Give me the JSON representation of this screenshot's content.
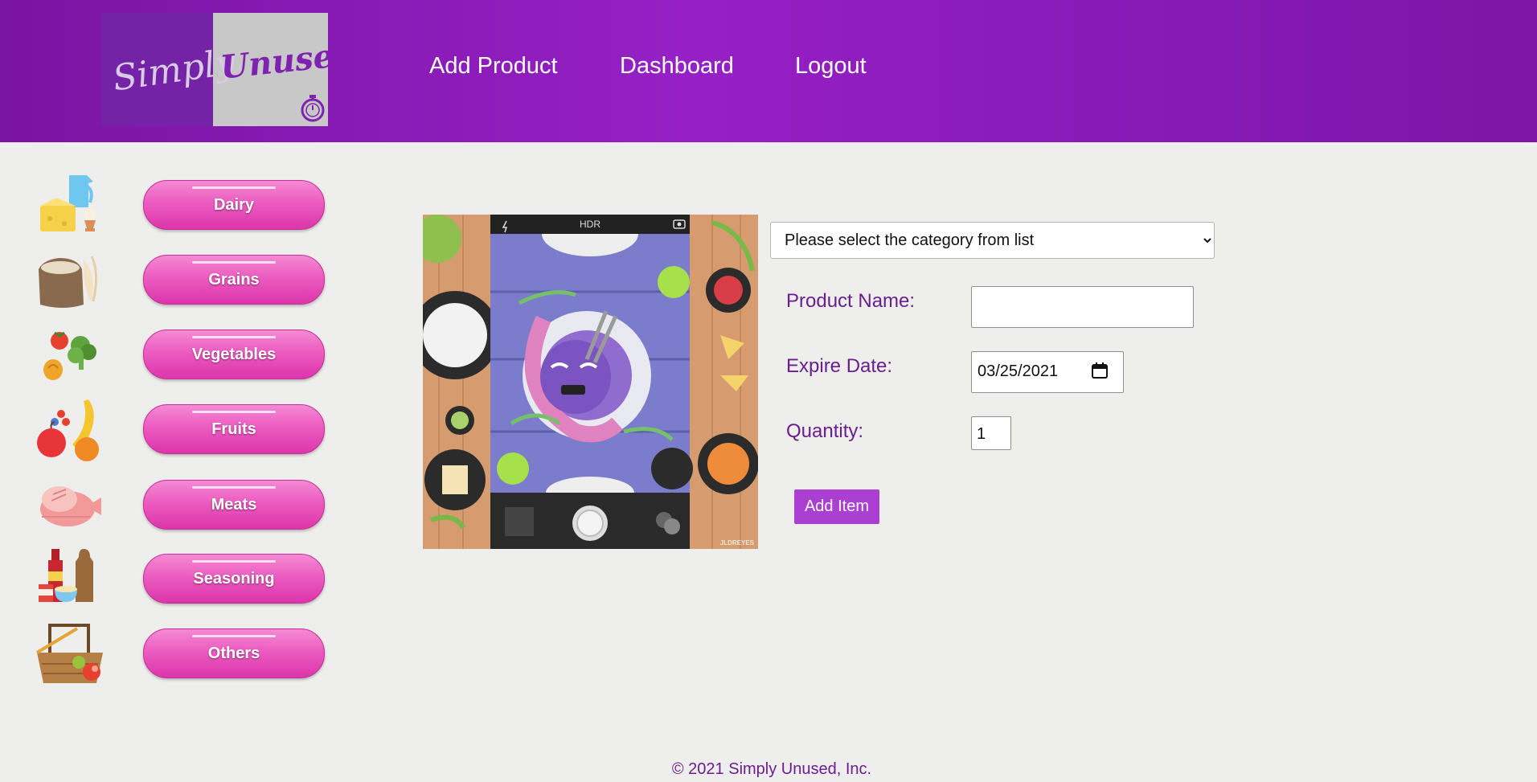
{
  "brand": {
    "logo_text_1": "Simply",
    "logo_text_2": "Unused",
    "accent": "#9620c6"
  },
  "nav": [
    {
      "label": "Add Product"
    },
    {
      "label": "Dashboard"
    },
    {
      "label": "Logout"
    }
  ],
  "categories": [
    {
      "label": "Dairy",
      "icon": "dairy-icon"
    },
    {
      "label": "Grains",
      "icon": "grain-sack-icon"
    },
    {
      "label": "Vegetables",
      "icon": "vegetables-icon"
    },
    {
      "label": "Fruits",
      "icon": "fruits-icon"
    },
    {
      "label": "Meats",
      "icon": "ham-icon"
    },
    {
      "label": "Seasoning",
      "icon": "condiments-icon"
    },
    {
      "label": "Others",
      "icon": "basket-icon"
    }
  ],
  "phone": {
    "hdr_label": "HDR",
    "watermark": "JLDREYES"
  },
  "form": {
    "category_select": {
      "selected": "Please select the category from list"
    },
    "product_name": {
      "label": "Product Name:",
      "value": ""
    },
    "expire_date": {
      "label": "Expire Date:",
      "value": "03/25/2021"
    },
    "quantity": {
      "label": "Quantity:",
      "value": "1"
    },
    "submit_label": "Add Item"
  },
  "footer": {
    "text": "© 2021 Simply Unused, Inc."
  }
}
